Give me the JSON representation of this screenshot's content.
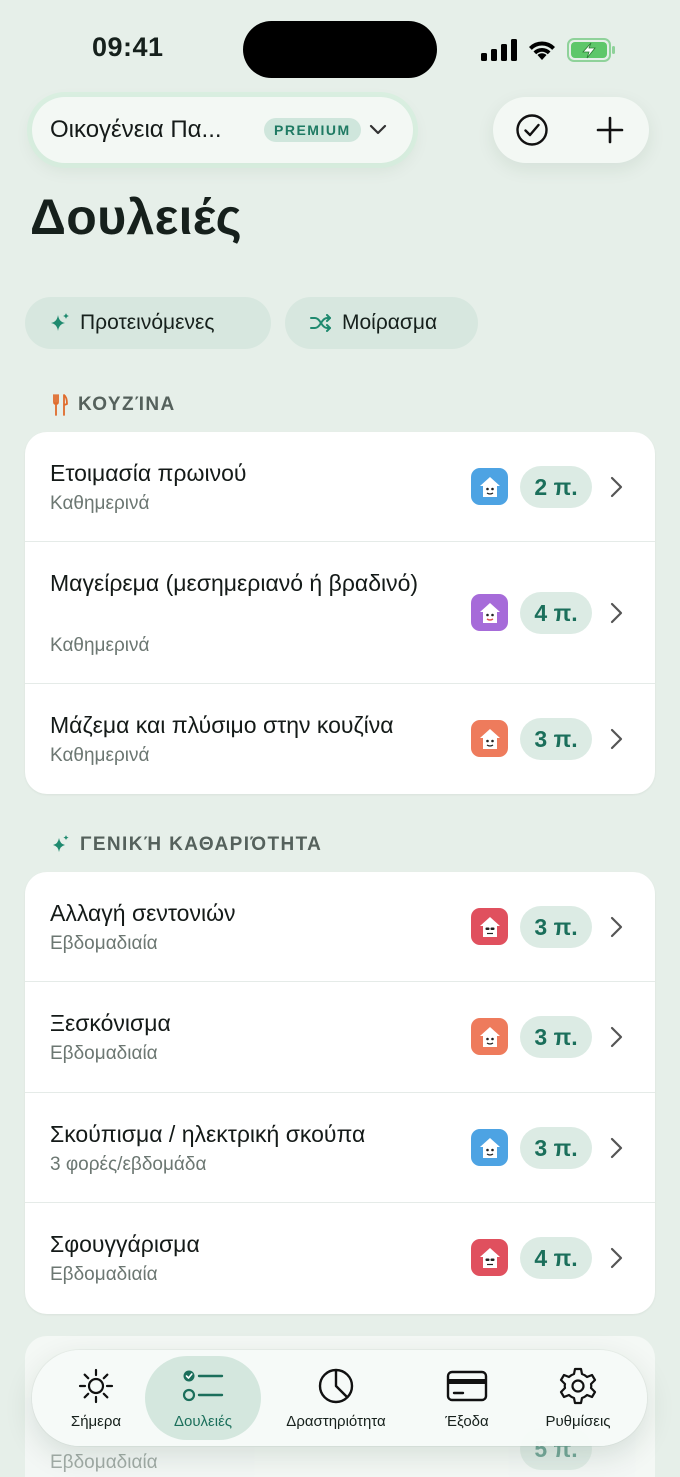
{
  "status_bar": {
    "time": "09:41"
  },
  "header": {
    "family_name": "Οικογένεια Πα...",
    "premium_badge": "PREMIUM",
    "title": "Δουλειές"
  },
  "chips": {
    "suggested": "Προτεινόμενες",
    "share": "Μοίρασμα"
  },
  "sections": [
    {
      "title": "ΚΟΥΖΊΝΑ",
      "icon": "fork-knife-icon",
      "chores": [
        {
          "title": "Ετοιμασία πρωινού",
          "frequency": "Καθημερινά",
          "points": "2 π.",
          "avatar_color": "#4da3e3"
        },
        {
          "title": "Μαγείρεμα (μεσημεριανό ή βραδινό)",
          "frequency": "Καθημερινά",
          "points": "4 π.",
          "avatar_color": "#a66bd9"
        },
        {
          "title": "Μάζεμα και πλύσιμο στην κουζίνα",
          "frequency": "Καθημερινά",
          "points": "3 π.",
          "avatar_color": "#ee7b5c"
        }
      ]
    },
    {
      "title": "ΓΕΝΙΚΉ ΚΑΘΑΡΙΌΤΗΤΑ",
      "icon": "sparkle-icon",
      "chores": [
        {
          "title": "Αλλαγή σεντονιών",
          "frequency": "Εβδομαδιαία",
          "points": "3 π.",
          "avatar_color": "#e0505e"
        },
        {
          "title": "Ξεσκόνισμα",
          "frequency": "Εβδομαδιαία",
          "points": "3 π.",
          "avatar_color": "#ee7b5c"
        },
        {
          "title": "Σκούπισμα / ηλεκτρική σκούπα",
          "frequency": "3 φορές/εβδομάδα",
          "points": "3 π.",
          "avatar_color": "#4da3e3"
        },
        {
          "title": "Σφουγγάρισμα",
          "frequency": "Εβδομαδιαία",
          "points": "4 π.",
          "avatar_color": "#e0505e"
        }
      ]
    }
  ],
  "peek": {
    "frequency": "Εβδομαδιαία",
    "points": "5 π."
  },
  "tabs": [
    {
      "label": "Σήμερα",
      "icon": "sun-icon"
    },
    {
      "label": "Δουλειές",
      "icon": "checklist-icon",
      "active": true
    },
    {
      "label": "Δραστηριότητα",
      "icon": "pie-chart-icon"
    },
    {
      "label": "Έξοδα",
      "icon": "credit-card-icon"
    },
    {
      "label": "Ρυθμίσεις",
      "icon": "gear-icon"
    }
  ],
  "colors": {
    "accent": "#1b6f5b",
    "background": "#e6efe9",
    "points_bg": "#dcebe4"
  }
}
